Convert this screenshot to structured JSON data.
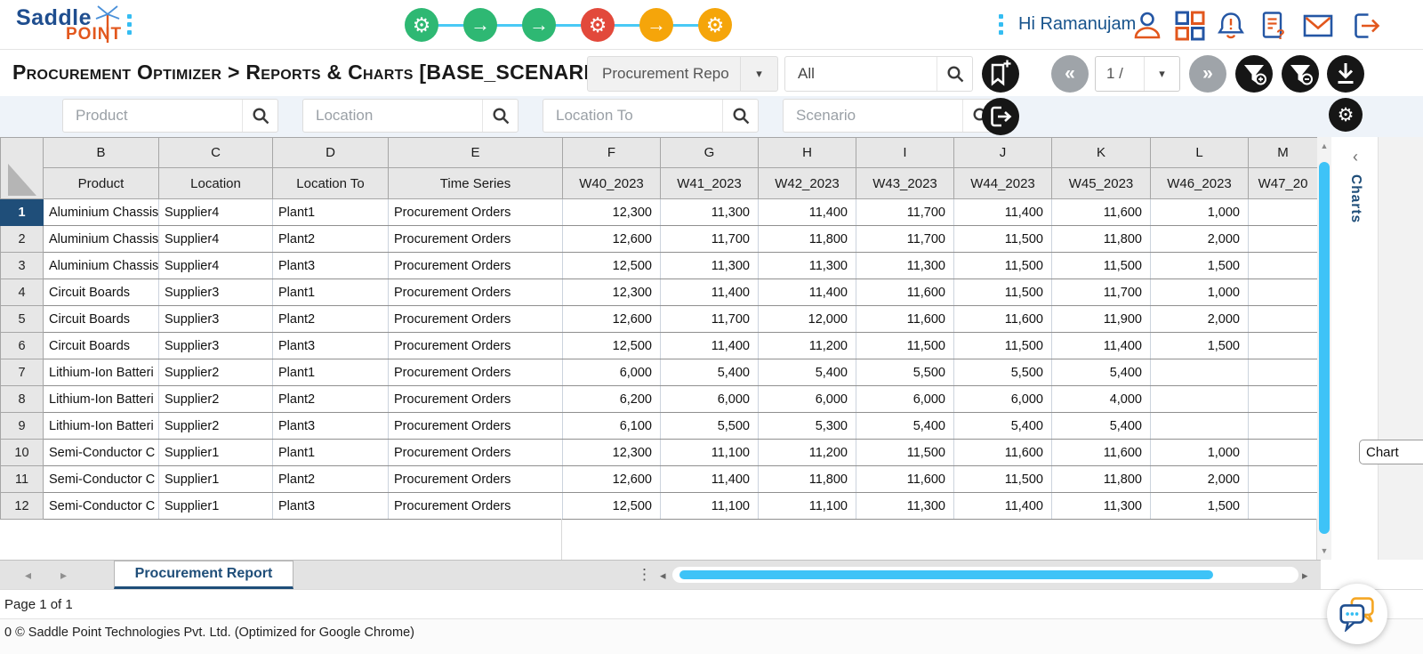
{
  "colors": {
    "brand_blue": "#1f4e8f",
    "brand_orange": "#e2571d",
    "accent_scroll_blue": "#3ec3f7",
    "selected_row_bg": "#1f4e79",
    "step_green": "#2eb873",
    "step_red": "#e2493b",
    "step_amber": "#f5a50a"
  },
  "icons": {
    "gear": "⚙",
    "arrow": "→",
    "prev": "«",
    "next": "»",
    "caret": "▾",
    "tab_dots": "⋮",
    "chevron_left": "‹",
    "sheet_prev": "◂",
    "sheet_next": "▸",
    "scroll_up": "▲",
    "scroll_down": "▼"
  },
  "header": {
    "logo_saddle": "Saddle",
    "logo_point": "POINT",
    "greeting": "Hi Ramanujam",
    "workflow_steps": [
      {
        "icon": "gear",
        "color": "#2eb873"
      },
      {
        "icon": "arrow",
        "color": "#2eb873"
      },
      {
        "icon": "arrow",
        "color": "#2eb873"
      },
      {
        "icon": "gear",
        "color": "#e2493b"
      },
      {
        "icon": "arrow",
        "color": "#f5a50a"
      },
      {
        "icon": "gear",
        "color": "#f5a50a"
      }
    ]
  },
  "toolbar": {
    "breadcrumb": "Procurement Optimizer > Reports & Charts [BASE_SCENARIO]",
    "report_selector_value": "Procurement Repo",
    "search_value": "All",
    "page_value": "1 /"
  },
  "filters": [
    {
      "placeholder": "Product"
    },
    {
      "placeholder": "Location"
    },
    {
      "placeholder": "Location To"
    },
    {
      "placeholder": "Scenario"
    }
  ],
  "table": {
    "column_letters": [
      "B",
      "C",
      "D",
      "E",
      "F",
      "G",
      "H",
      "I",
      "J",
      "K",
      "L",
      "M"
    ],
    "headers": [
      "Product",
      "Location",
      "Location To",
      "Time Series",
      "W40_2023",
      "W41_2023",
      "W42_2023",
      "W43_2023",
      "W44_2023",
      "W45_2023",
      "W46_2023",
      "W47_20"
    ],
    "selected_row": 1,
    "rows": [
      [
        "Aluminium Chassis",
        "Supplier4",
        "Plant1",
        "Procurement Orders",
        "12,300",
        "11,300",
        "11,400",
        "11,700",
        "11,400",
        "11,600",
        "1,000",
        ""
      ],
      [
        "Aluminium Chassis",
        "Supplier4",
        "Plant2",
        "Procurement Orders",
        "12,600",
        "11,700",
        "11,800",
        "11,700",
        "11,500",
        "11,800",
        "2,000",
        ""
      ],
      [
        "Aluminium Chassis",
        "Supplier4",
        "Plant3",
        "Procurement Orders",
        "12,500",
        "11,300",
        "11,300",
        "11,300",
        "11,500",
        "11,500",
        "1,500",
        ""
      ],
      [
        "Circuit Boards",
        "Supplier3",
        "Plant1",
        "Procurement Orders",
        "12,300",
        "11,400",
        "11,400",
        "11,600",
        "11,500",
        "11,700",
        "1,000",
        ""
      ],
      [
        "Circuit Boards",
        "Supplier3",
        "Plant2",
        "Procurement Orders",
        "12,600",
        "11,700",
        "12,000",
        "11,600",
        "11,600",
        "11,900",
        "2,000",
        ""
      ],
      [
        "Circuit Boards",
        "Supplier3",
        "Plant3",
        "Procurement Orders",
        "12,500",
        "11,400",
        "11,200",
        "11,500",
        "11,500",
        "11,400",
        "1,500",
        ""
      ],
      [
        "Lithium-Ion Batteri",
        "Supplier2",
        "Plant1",
        "Procurement Orders",
        "6,000",
        "5,400",
        "5,400",
        "5,500",
        "5,500",
        "5,400",
        "",
        ""
      ],
      [
        "Lithium-Ion Batteri",
        "Supplier2",
        "Plant2",
        "Procurement Orders",
        "6,200",
        "6,000",
        "6,000",
        "6,000",
        "6,000",
        "4,000",
        "",
        ""
      ],
      [
        "Lithium-Ion Batteri",
        "Supplier2",
        "Plant3",
        "Procurement Orders",
        "6,100",
        "5,500",
        "5,300",
        "5,400",
        "5,400",
        "5,400",
        "",
        ""
      ],
      [
        "Semi-Conductor C",
        "Supplier1",
        "Plant1",
        "Procurement Orders",
        "12,300",
        "11,100",
        "11,200",
        "11,500",
        "11,600",
        "11,600",
        "1,000",
        ""
      ],
      [
        "Semi-Conductor C",
        "Supplier1",
        "Plant2",
        "Procurement Orders",
        "12,600",
        "11,400",
        "11,800",
        "11,600",
        "11,500",
        "11,800",
        "2,000",
        ""
      ],
      [
        "Semi-Conductor C",
        "Supplier1",
        "Plant3",
        "Procurement Orders",
        "12,500",
        "11,100",
        "11,100",
        "11,300",
        "11,400",
        "11,300",
        "1,500",
        ""
      ]
    ]
  },
  "side_panel": {
    "title": "Charts",
    "chart_button": "Chart"
  },
  "sheet_tab": "Procurement Report",
  "status": "Page 1 of 1",
  "footer": "0 © Saddle Point Technologies Pvt. Ltd.  (Optimized for Google Chrome)"
}
